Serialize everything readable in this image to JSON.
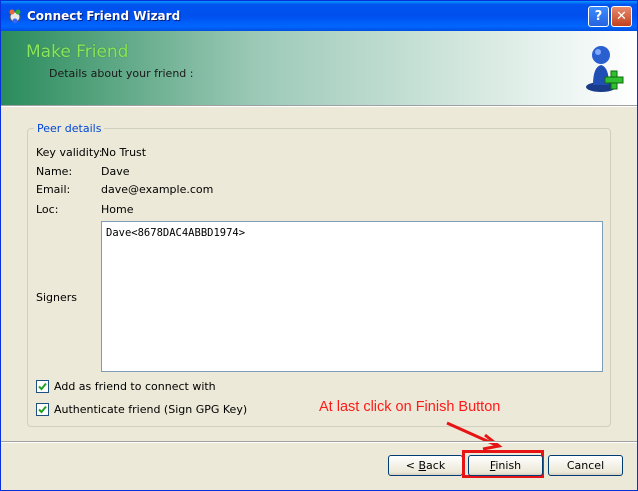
{
  "window": {
    "title": "Connect Friend Wizard",
    "help_label": "?",
    "close_label": "✕"
  },
  "header": {
    "title": "Make Friend",
    "subtitle": "Details about your friend :"
  },
  "peer": {
    "group_label": "Peer details",
    "fields": [
      {
        "label": "Key validity:",
        "value": "No Trust"
      },
      {
        "label": "Name:",
        "value": "Dave"
      },
      {
        "label": "Email:",
        "value": "dave@example.com"
      },
      {
        "label": "Loc:",
        "value": "Home"
      }
    ],
    "signers_label": "Signers",
    "signers_value": "Dave<8678DAC4ABBD1974>"
  },
  "options": [
    {
      "label": "Add as friend to connect with",
      "checked": true
    },
    {
      "label": "Authenticate friend (Sign GPG Key)",
      "checked": true
    }
  ],
  "annotation": {
    "text": "At last click on Finish Button",
    "color": "#ff1a1a"
  },
  "buttons": {
    "back": {
      "prefix": "< ",
      "accel": "B",
      "rest": "ack"
    },
    "finish": {
      "accel": "F",
      "rest": "inish"
    },
    "cancel": "Cancel"
  },
  "icons": {
    "app": "app-wizard-icon",
    "header": "user-add-icon"
  }
}
